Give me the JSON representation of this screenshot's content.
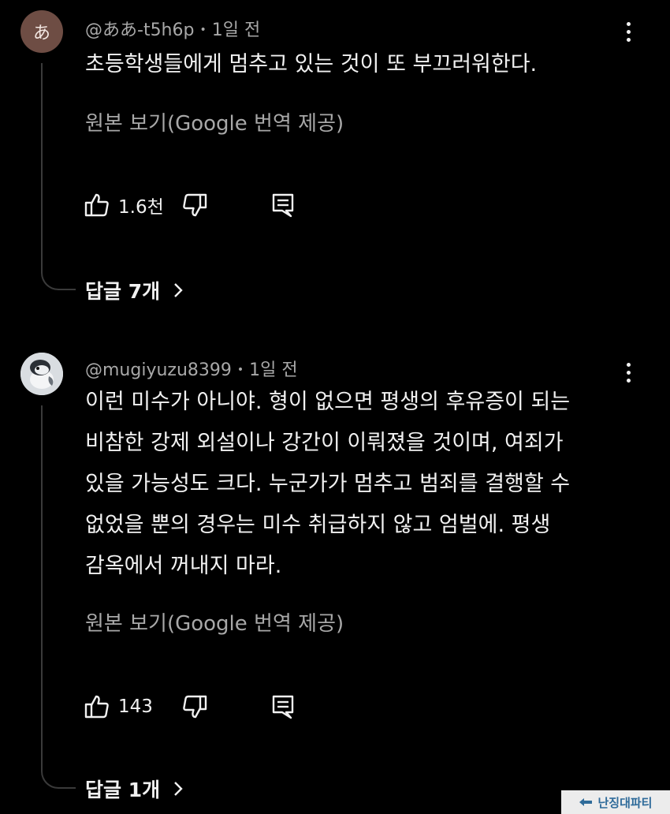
{
  "comments": [
    {
      "avatar_initial": "あ",
      "author": "@ああ-t5h6p",
      "time": "1일 전",
      "text": "초등학생들에게 멈추고 있는 것이 또 부끄러워한다.",
      "translate_label": "원본 보기(Google 번역 제공)",
      "likes": "1.6천",
      "replies_label": "답글 7개"
    },
    {
      "author": "@mugiyuzu8399",
      "time": "1일 전",
      "text_lines": [
        "이런 미수가 아니야. 형이 없으면 평생의 후유증이 되는",
        "비참한 강제 외설이나 강간이 이뤄졌을 것이며, 여죄가",
        "있을 가능성도 크다. 누군가가 멈추고 범죄를 결행할 수",
        "없었을 뿐의 경우는 미수 취급하지 않고 엄벌에. 평생",
        "감옥에서 꺼내지 마라."
      ],
      "translate_label": "원본 보기(Google 번역 제공)",
      "likes": "143",
      "replies_label": "답글 1개"
    }
  ],
  "icons": {
    "like": "thumb-up-icon",
    "dislike": "thumb-down-icon",
    "reply": "reply-comment-icon",
    "more": "more-vert-icon",
    "chevron": "chevron-right-icon"
  },
  "watermark": {
    "text": "난징대파티"
  },
  "colors": {
    "background": "#000000",
    "text": "#f1f1f1",
    "secondary": "#a8a8a8",
    "avatar1": "#6e4d44"
  }
}
